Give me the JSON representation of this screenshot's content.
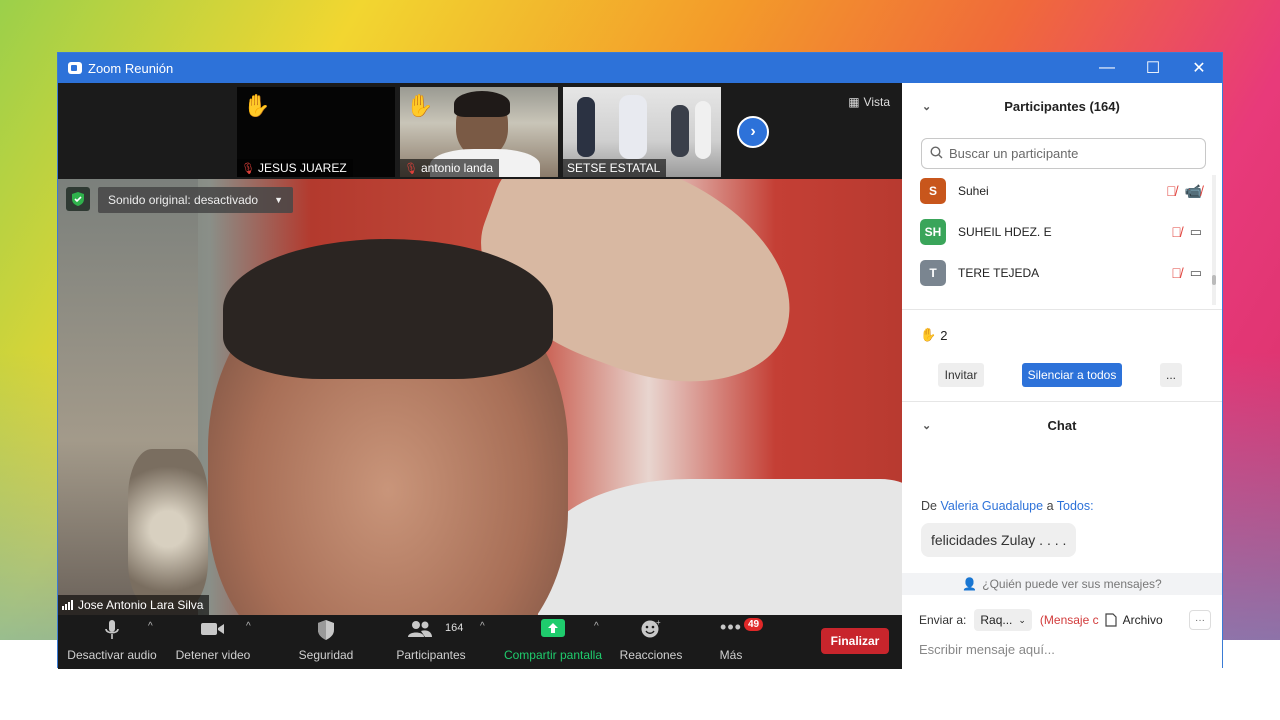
{
  "window": {
    "title": "Zoom Reunión",
    "controls": [
      "minimize",
      "maximize",
      "close"
    ]
  },
  "strip": {
    "thumbnails": [
      {
        "name": "JESUS JUAREZ",
        "hand_raised": true,
        "muted": true
      },
      {
        "name": "antonio landa",
        "hand_raised": true,
        "muted": true
      },
      {
        "name": "SETSE ESTATAL",
        "hand_raised": false,
        "muted": false
      }
    ],
    "view_label": "Vista"
  },
  "main_video": {
    "original_sound": "Sonido original: desactivado",
    "speaker_name": "Jose Antonio Lara Silva"
  },
  "toolbar": {
    "mute": "Desactivar audio",
    "video": "Detener video",
    "security": "Seguridad",
    "participants": "Participantes",
    "participants_count": "164",
    "share": "Compartir pantalla",
    "reactions": "Reacciones",
    "more": "Más",
    "more_badge": "49",
    "end": "Finalizar"
  },
  "participants_panel": {
    "title": "Participantes (164)",
    "search_placeholder": "Buscar un participante",
    "list": [
      {
        "initials": "S",
        "name": "Suhei",
        "color": "#c8561c",
        "video_off": true
      },
      {
        "initials": "SH",
        "name": "SUHEIL HDEZ. E",
        "color": "#3aa55a",
        "video_off": false
      },
      {
        "initials": "T",
        "name": "TERE TEJEDA",
        "color": "#7a8590",
        "video_off": false
      }
    ],
    "raised_hands": "2",
    "invite": "Invitar",
    "mute_all": "Silenciar a todos",
    "more": "..."
  },
  "chat": {
    "title": "Chat",
    "from_prefix": "De",
    "from_user": "Valeria Guadalupe",
    "to_word": "a",
    "to_target": "Todos:",
    "message": "felicidades Zulay . . . .",
    "who_sees": "¿Quién puede ver sus mensajes?",
    "send_to_label": "Enviar a:",
    "send_to_value": "Raq...",
    "private_hint": "(Mensaje c",
    "file_label": "Archivo",
    "more": "···",
    "input_placeholder": "Escribir mensaje aquí..."
  },
  "colors": {
    "zoom_blue": "#2d72d9",
    "end_red": "#c8252c",
    "share_green": "#1fcc6d"
  }
}
